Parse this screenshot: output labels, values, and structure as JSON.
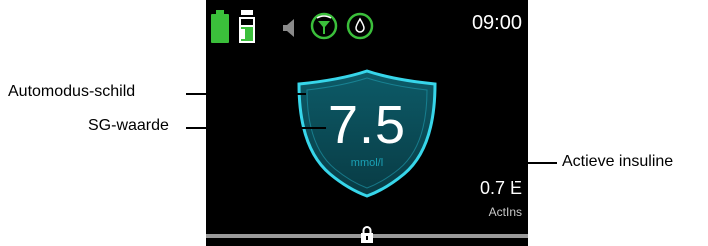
{
  "status_bar": {
    "time": "09:00",
    "icons": [
      "battery-icon",
      "reservoir-icon",
      "speaker-icon",
      "sensor-signal-icon",
      "drop-icon"
    ]
  },
  "sensor": {
    "sg_value": "7.5",
    "sg_unit": "mmol/l"
  },
  "active_insulin": {
    "value": "0.7 E",
    "label": "ActIns"
  },
  "callouts": {
    "automode_shield": "Automodus-schild",
    "sg_value": "SG-waarde",
    "active_insulin": "Actieve insuline"
  },
  "colors": {
    "battery": "#3bbf3b",
    "shield": "#1f9fb3",
    "shield_glow": "#37d6ea",
    "screen_bg": "#000000"
  }
}
